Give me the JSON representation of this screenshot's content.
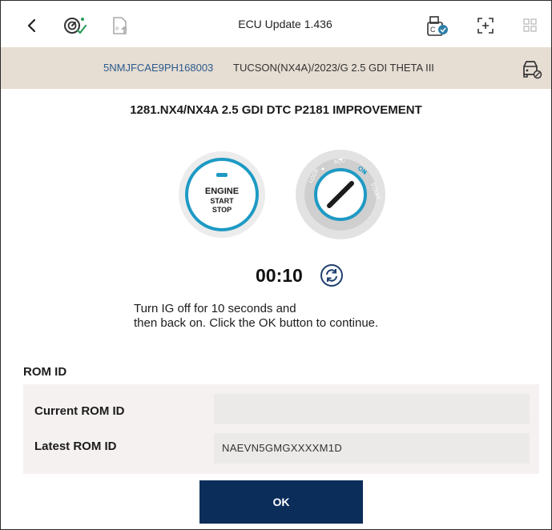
{
  "topbar": {
    "title": "ECU Update 1.436",
    "icons": [
      "back-chevron-icon",
      "diagnostic-gauge-icon",
      "file-upload-icon",
      "printer-scan-icon",
      "fullscreen-icon",
      "grid-icon"
    ]
  },
  "vehicle": {
    "vin": "5NMJFCAE9PH168003",
    "description": "TUCSON(NX4A)/2023/G 2.5 GDI THETA III",
    "icon": "car-settings-icon"
  },
  "procedure": {
    "heading": "1281.NX4/NX4A 2.5 GDI DTC P2181 IMPROVEMENT"
  },
  "engine_button": {
    "line1": "ENGINE",
    "line2": "START",
    "line3": "STOP"
  },
  "ignition": {
    "positions": [
      "LOCK",
      "ACC",
      "ON",
      "START"
    ],
    "active": "ON"
  },
  "timer": {
    "value": "00:10"
  },
  "instruction": {
    "line1": "Turn IG off for 10 seconds and",
    "line2": "then back on. Click the OK button to continue."
  },
  "rom": {
    "section_title": "ROM ID",
    "current_label": "Current ROM ID",
    "current_value": "",
    "latest_label": "Latest ROM ID",
    "latest_value": "NAEVN5GMGXXXXM1D"
  },
  "actions": {
    "ok_label": "OK"
  },
  "colors": {
    "vehicle_bar": "#e6ddd3",
    "vin_text": "#2b5b8c",
    "ok_button": "#0b2d5a",
    "accent_teal": "#1e9ac4"
  }
}
